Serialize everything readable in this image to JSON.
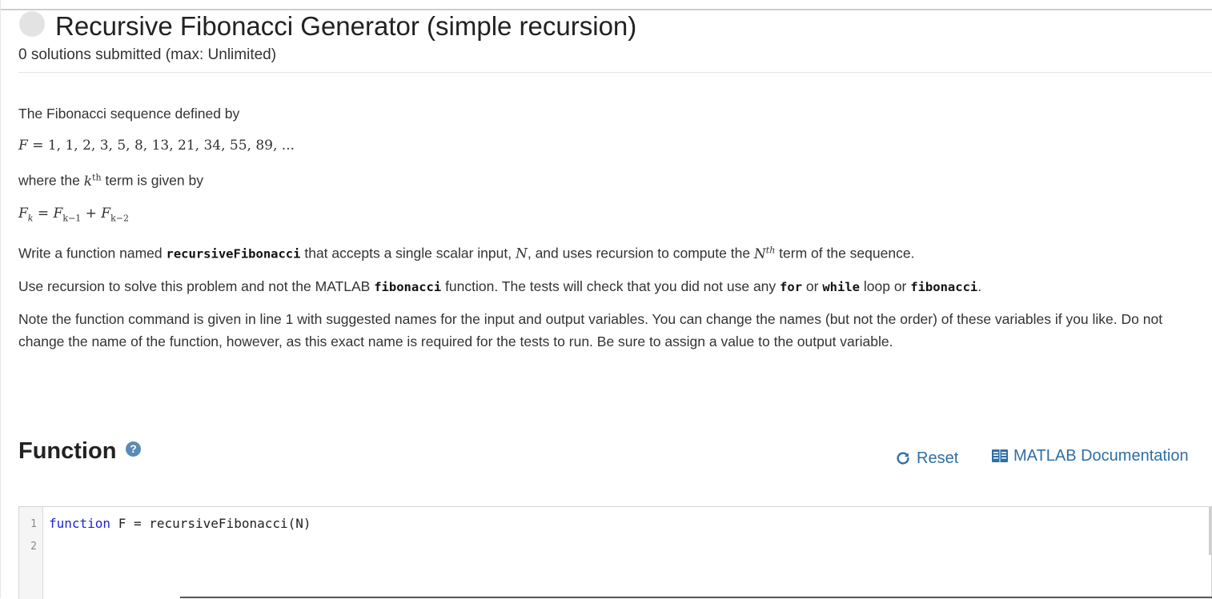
{
  "problem": {
    "title": "Recursive Fibonacci Generator (simple recursion)",
    "subtitle": "0 solutions submitted (max: Unlimited)"
  },
  "description": {
    "p1": "The Fibonacci sequence defined by",
    "sequence_lhs": "F",
    "sequence_rhs": "= 1, 1, 2, 3, 5, 8, 13, 21, 34, 55, 89, ...",
    "p2_before": "where the ",
    "p2_k": "k",
    "p2_sup": "th",
    "p2_after": " term is given by",
    "recurrence": {
      "F": "F",
      "k": "k",
      "eq": " = ",
      "km1": "k−1",
      "plus": " + ",
      "km2": "k−2"
    },
    "p3_a": "Write a function named ",
    "p3_code": "recursiveFibonacci",
    "p3_b": " that accepts a single scalar input, ",
    "p3_N": "N",
    "p3_c": ", and uses recursion to compute the ",
    "p3_Nth_N": "N",
    "p3_Nth_sup": "th",
    "p3_d": " term of the sequence.",
    "p4_a": "Use recursion to solve this problem and not the MATLAB ",
    "p4_code1": "fibonacci",
    "p4_b": " function.  The tests will check that you did not use any ",
    "p4_code2": "for",
    "p4_c": " or ",
    "p4_code3": "while",
    "p4_d": " loop or ",
    "p4_code4": "fibonacci",
    "p4_e": ".",
    "p5": "Note the function command is given in line 1 with suggested names for the input and output variables.  You can change the names (but not the order) of these variables if you like.  Do not change the name of the function, however, as this exact name is required for the tests to run.  Be sure to assign a value to the output variable."
  },
  "function_section": {
    "title": "Function",
    "help_icon": "question-circle-icon",
    "reset_label": "Reset",
    "reset_icon": "refresh-icon",
    "docs_label": "MATLAB Documentation",
    "docs_icon": "book-icon"
  },
  "editor": {
    "line_numbers": [
      "1",
      "2"
    ],
    "line1_keyword": "function",
    "line1_rest": " F = recursiveFibonacci(N)",
    "line2": ""
  },
  "colors": {
    "link": "#2f6fa6",
    "keyword": "#1f26d6",
    "help_icon": "#5b8ab5"
  }
}
